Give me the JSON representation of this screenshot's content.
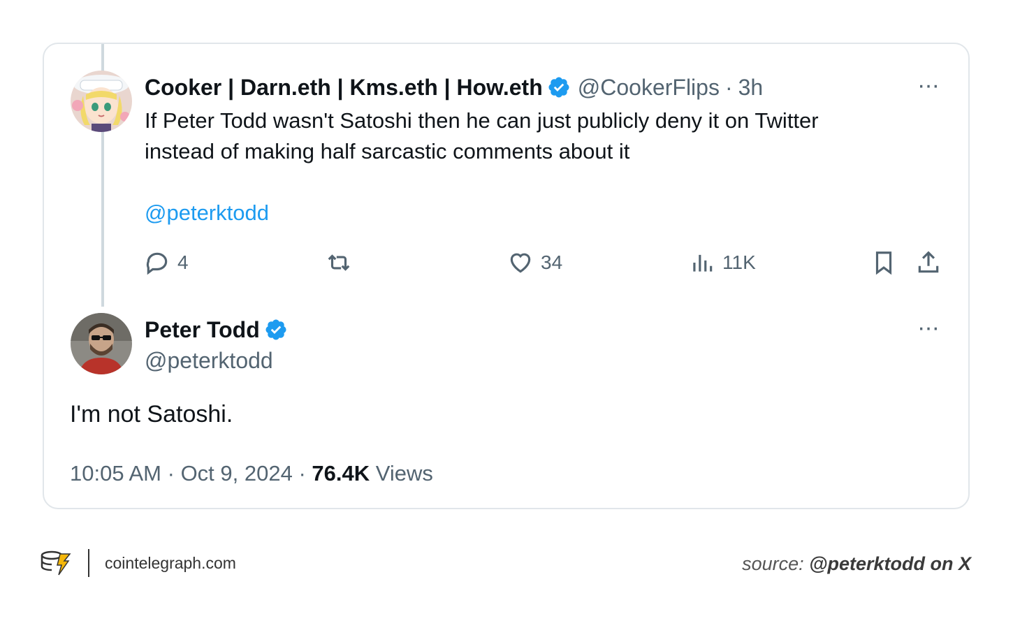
{
  "quoted_tweet": {
    "display_name": "Cooker | Darn.eth | Kms.eth | How.eth",
    "handle": "@CookerFlips",
    "separator": "·",
    "time": "3h",
    "text_line1": "If Peter Todd wasn't Satoshi then he can just publicly deny it on Twitter",
    "text_line2": "instead of making half sarcastic comments about it",
    "mention": "@peterktodd",
    "more_label": "···",
    "stats": {
      "replies": "4",
      "likes": "34",
      "views": "11K"
    },
    "icons": [
      "reply-icon",
      "retweet-icon",
      "like-icon",
      "views-icon",
      "bookmark-icon",
      "share-icon",
      "verified-icon"
    ]
  },
  "main_tweet": {
    "display_name": "Peter Todd",
    "handle": "@peterktodd",
    "text": "I'm not Satoshi.",
    "more_label": "···",
    "time": "10:05 AM",
    "date": "Oct 9, 2024",
    "separator": "·",
    "views_count": "76.4K",
    "views_label": "Views"
  },
  "brand": {
    "site": "cointelegraph.com",
    "icon": "cointelegraph-logo-icon"
  },
  "source": {
    "prefix": "source:",
    "credit": "@peterktodd on X"
  },
  "colors": {
    "link": "#1d9bf0",
    "muted": "#536471",
    "border": "#e1e6ea",
    "verified": "#1d9bf0",
    "brand_yellow": "#f5b70a"
  }
}
